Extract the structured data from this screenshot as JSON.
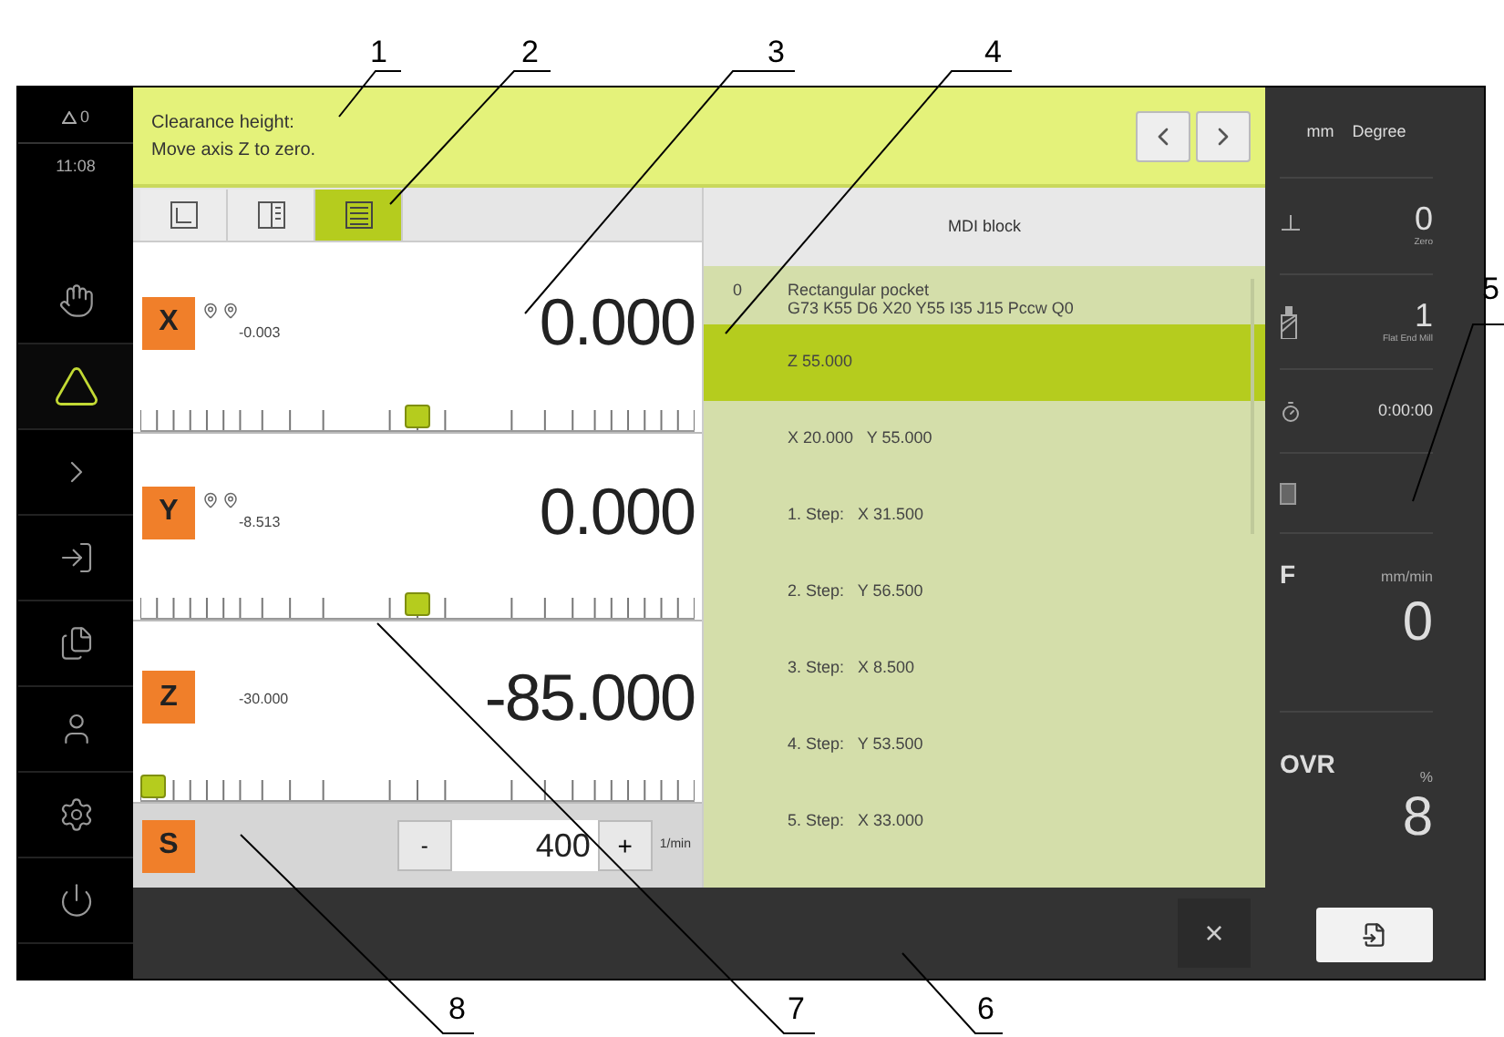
{
  "status": {
    "warnings": "0",
    "time": "11:08"
  },
  "sidebar": {
    "items": [
      {
        "kind": "hand",
        "selected": false
      },
      {
        "kind": "triangle",
        "selected": true
      },
      {
        "kind": "arrow",
        "selected": false
      },
      {
        "kind": "enter",
        "selected": false
      },
      {
        "kind": "files",
        "selected": false
      },
      {
        "kind": "user",
        "selected": false
      },
      {
        "kind": "settings",
        "selected": false
      },
      {
        "kind": "power",
        "selected": false
      }
    ]
  },
  "message": {
    "lines": [
      "Clearance height:",
      "Move axis Z to zero."
    ]
  },
  "view_tabs": [
    {
      "kind": "axes",
      "selected": false
    },
    {
      "kind": "split",
      "selected": false
    },
    {
      "kind": "list",
      "selected": true
    }
  ],
  "axes": [
    {
      "label": "X",
      "secondary": "-0.003",
      "markers": true,
      "value": "0.000",
      "level": 0.5
    },
    {
      "label": "Y",
      "secondary": "-8.513",
      "markers": true,
      "value": "0.000",
      "level": 0.5
    },
    {
      "label": "Z",
      "secondary": "-30.000",
      "markers": false,
      "value": "-85.000",
      "level": 0
    }
  ],
  "spindle": {
    "label": "S",
    "minus": "-",
    "value": "400",
    "plus": "+",
    "unit": "1/min"
  },
  "mdi": {
    "title": "MDI block",
    "index": "0",
    "block_name": "Rectangular pocket",
    "block_code": "G73 K55 D6 X20 Y55 I35 J15 Pccw Q0",
    "rows": [
      {
        "text": "Z 55.000",
        "selected": true
      },
      {
        "text": "X 20.000   Y 55.000",
        "selected": false
      },
      {
        "text": "1. Step:   X 31.500",
        "selected": false
      },
      {
        "text": "2. Step:   Y 56.500",
        "selected": false
      },
      {
        "text": "3. Step:   X 8.500",
        "selected": false
      },
      {
        "text": "4. Step:   Y 53.500",
        "selected": false
      },
      {
        "text": "5. Step:   X 33.000",
        "selected": false
      }
    ]
  },
  "right_panel": {
    "units": [
      "mm",
      "Degree"
    ],
    "zero": {
      "value": "0",
      "caption": "Zero"
    },
    "tool": {
      "value": "1",
      "caption": "Flat End Mill"
    },
    "timer": "0:00:00",
    "feed": {
      "label": "F",
      "unit": "mm/min",
      "value": "0"
    },
    "override": {
      "label": "OVR",
      "unit": "%",
      "value": "8"
    }
  },
  "bottom_bar": {
    "close": "×"
  },
  "callouts": [
    {
      "label": "1"
    },
    {
      "label": "2"
    },
    {
      "label": "3"
    },
    {
      "label": "4"
    },
    {
      "label": "5"
    },
    {
      "label": "8"
    },
    {
      "label": "7"
    },
    {
      "label": "6"
    }
  ]
}
